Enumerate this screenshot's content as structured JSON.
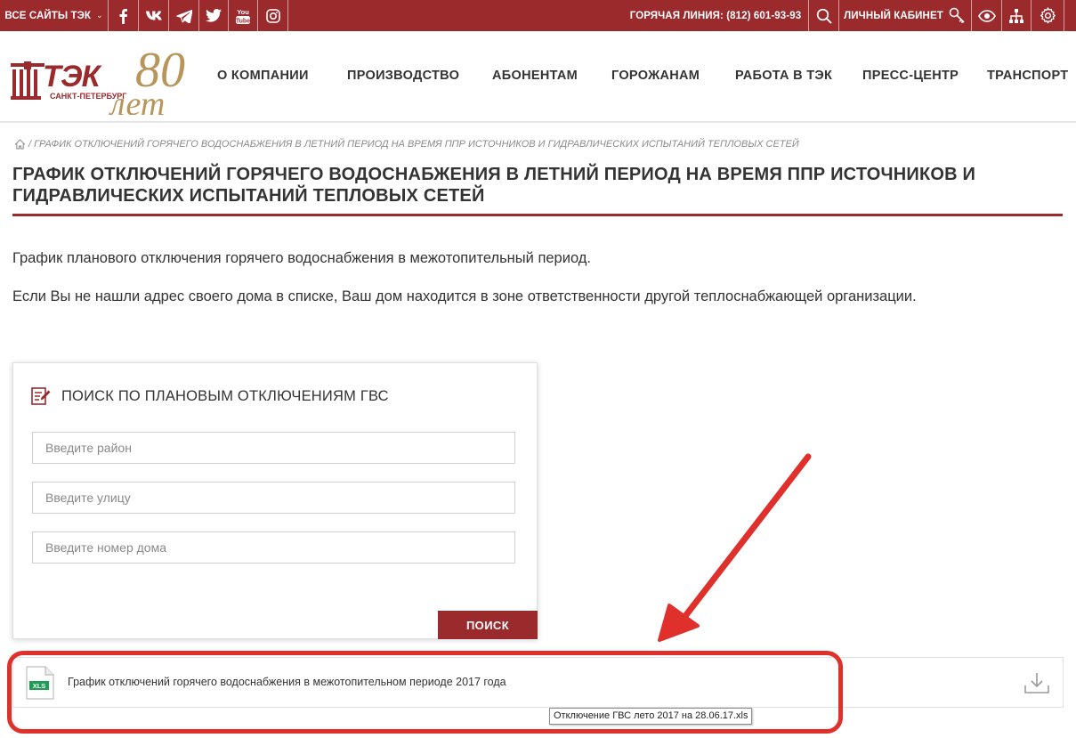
{
  "topbar": {
    "all_sites": "ВСЕ САЙТЫ ТЭК",
    "social_icons": [
      "facebook-icon",
      "vk-icon",
      "telegram-icon",
      "twitter-icon",
      "youtube-icon",
      "instagram-icon"
    ],
    "hotline": "ГОРЯЧАЯ ЛИНИЯ: (812) 601-93-93",
    "account": "ЛИЧНЫЙ КАБИНЕТ",
    "right_icons": [
      "search-icon",
      "key-icon",
      "eye-icon",
      "sitemap-icon",
      "gear-icon"
    ]
  },
  "logo": {
    "brand": "ТЭК",
    "city": "САНКТ-ПЕТЕРБУРГ",
    "anniversary_number": "80",
    "anniversary_word": "лет"
  },
  "nav": {
    "items": [
      {
        "label": "О КОМПАНИИ"
      },
      {
        "label": "ПРОИЗВОДСТВО"
      },
      {
        "label": "АБОНЕНТАМ"
      },
      {
        "label": "ГОРОЖАНАМ"
      },
      {
        "label": "РАБОТА В ТЭК"
      },
      {
        "label": "ПРЕСС-ЦЕНТР"
      },
      {
        "label": "ТРАНСПОРТ"
      }
    ]
  },
  "breadcrumb": {
    "separator": "/",
    "current": "ГРАФИК ОТКЛЮЧЕНИЙ ГОРЯЧЕГО ВОДОСНАБЖЕНИЯ В ЛЕТНИЙ ПЕРИОД НА ВРЕМЯ ППР ИСТОЧНИКОВ И ГИДРАВЛИЧЕСКИХ ИСПЫТАНИЙ ТЕПЛОВЫХ СЕТЕЙ"
  },
  "page": {
    "title": "ГРАФИК ОТКЛЮЧЕНИЙ ГОРЯЧЕГО ВОДОСНАБЖЕНИЯ В ЛЕТНИЙ ПЕРИОД НА ВРЕМЯ ППР ИСТОЧНИКОВ И ГИДРАВЛИЧЕСКИХ ИСПЫТАНИЙ ТЕПЛОВЫХ СЕТЕЙ",
    "intro": "График планового отключения горячего водоснабжения в межотопительный период.",
    "note": "Если Вы не нашли адрес своего дома в списке, Ваш дом находится в зоне ответственности другой теплоснабжающей организации."
  },
  "search_panel": {
    "title": "ПОИСК ПО ПЛАНОВЫМ ОТКЛЮЧЕНИЯМ ГВС",
    "district_placeholder": "Введите район",
    "street_placeholder": "Введите улицу",
    "house_placeholder": "Введите номер дома",
    "button": "ПОИСК"
  },
  "file": {
    "type_badge": "XLS",
    "name": "График отключений горячего водоснабжения в межотопительном периоде 2017 года",
    "tooltip": "Отключение ГВС лето 2017 на 28.06.17.xls"
  },
  "colors": {
    "brand": "#9b2a2d",
    "gold": "#b8955a",
    "annotation": "#e0302b",
    "xls_green": "#1f9d55"
  }
}
